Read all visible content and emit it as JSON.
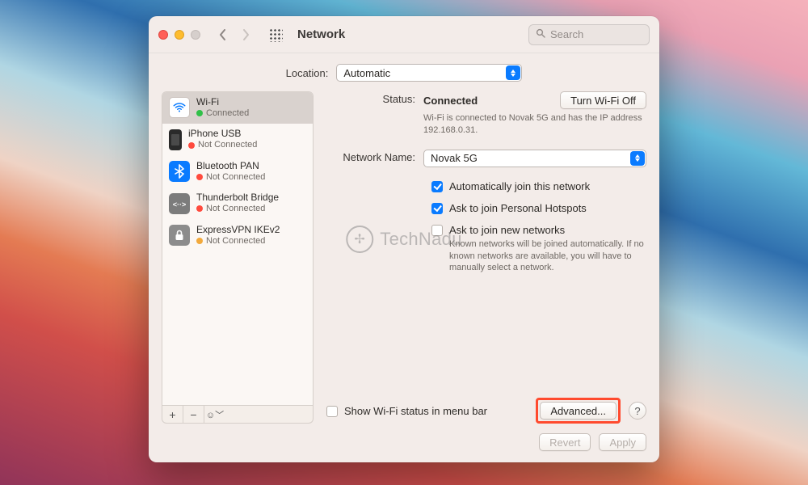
{
  "window": {
    "title": "Network"
  },
  "search": {
    "placeholder": "Search"
  },
  "location": {
    "label": "Location:",
    "value": "Automatic"
  },
  "sidebar": {
    "items": [
      {
        "name": "Wi-Fi",
        "status": "Connected",
        "color": "#30c048",
        "selected": true,
        "icon": "wifi-icon"
      },
      {
        "name": "iPhone USB",
        "status": "Not Connected",
        "color": "#ff4a3d",
        "selected": false,
        "icon": "iphone-icon"
      },
      {
        "name": "Bluetooth PAN",
        "status": "Not Connected",
        "color": "#ff4a3d",
        "selected": false,
        "icon": "bluetooth-icon"
      },
      {
        "name": "Thunderbolt Bridge",
        "status": "Not Connected",
        "color": "#ff4a3d",
        "selected": false,
        "icon": "thunderbolt-icon"
      },
      {
        "name": "ExpressVPN IKEv2",
        "status": "Not Connected",
        "color": "#f2a93c",
        "selected": false,
        "icon": "lock-icon"
      }
    ],
    "footer": {
      "add": "+",
      "remove": "−",
      "actions": "☺︎﹀"
    }
  },
  "detail": {
    "status_label": "Status:",
    "status_value": "Connected",
    "toggle_button": "Turn Wi-Fi Off",
    "status_sub": "Wi-Fi is connected to Novak 5G and has the IP address 192.168.0.31.",
    "network_label": "Network Name:",
    "network_value": "Novak 5G",
    "auto_join": {
      "checked": true,
      "label": "Automatically join this network"
    },
    "hotspots": {
      "checked": true,
      "label": "Ask to join Personal Hotspots"
    },
    "new_nets": {
      "checked": false,
      "label": "Ask to join new networks",
      "sub": "Known networks will be joined automatically. If no known networks are available, you will have to manually select a network."
    },
    "menubar": {
      "checked": false,
      "label": "Show Wi-Fi status in menu bar"
    },
    "advanced_button": "Advanced...",
    "help_button": "?"
  },
  "window_footer": {
    "revert": "Revert",
    "apply": "Apply"
  },
  "watermark": "TechNadu"
}
